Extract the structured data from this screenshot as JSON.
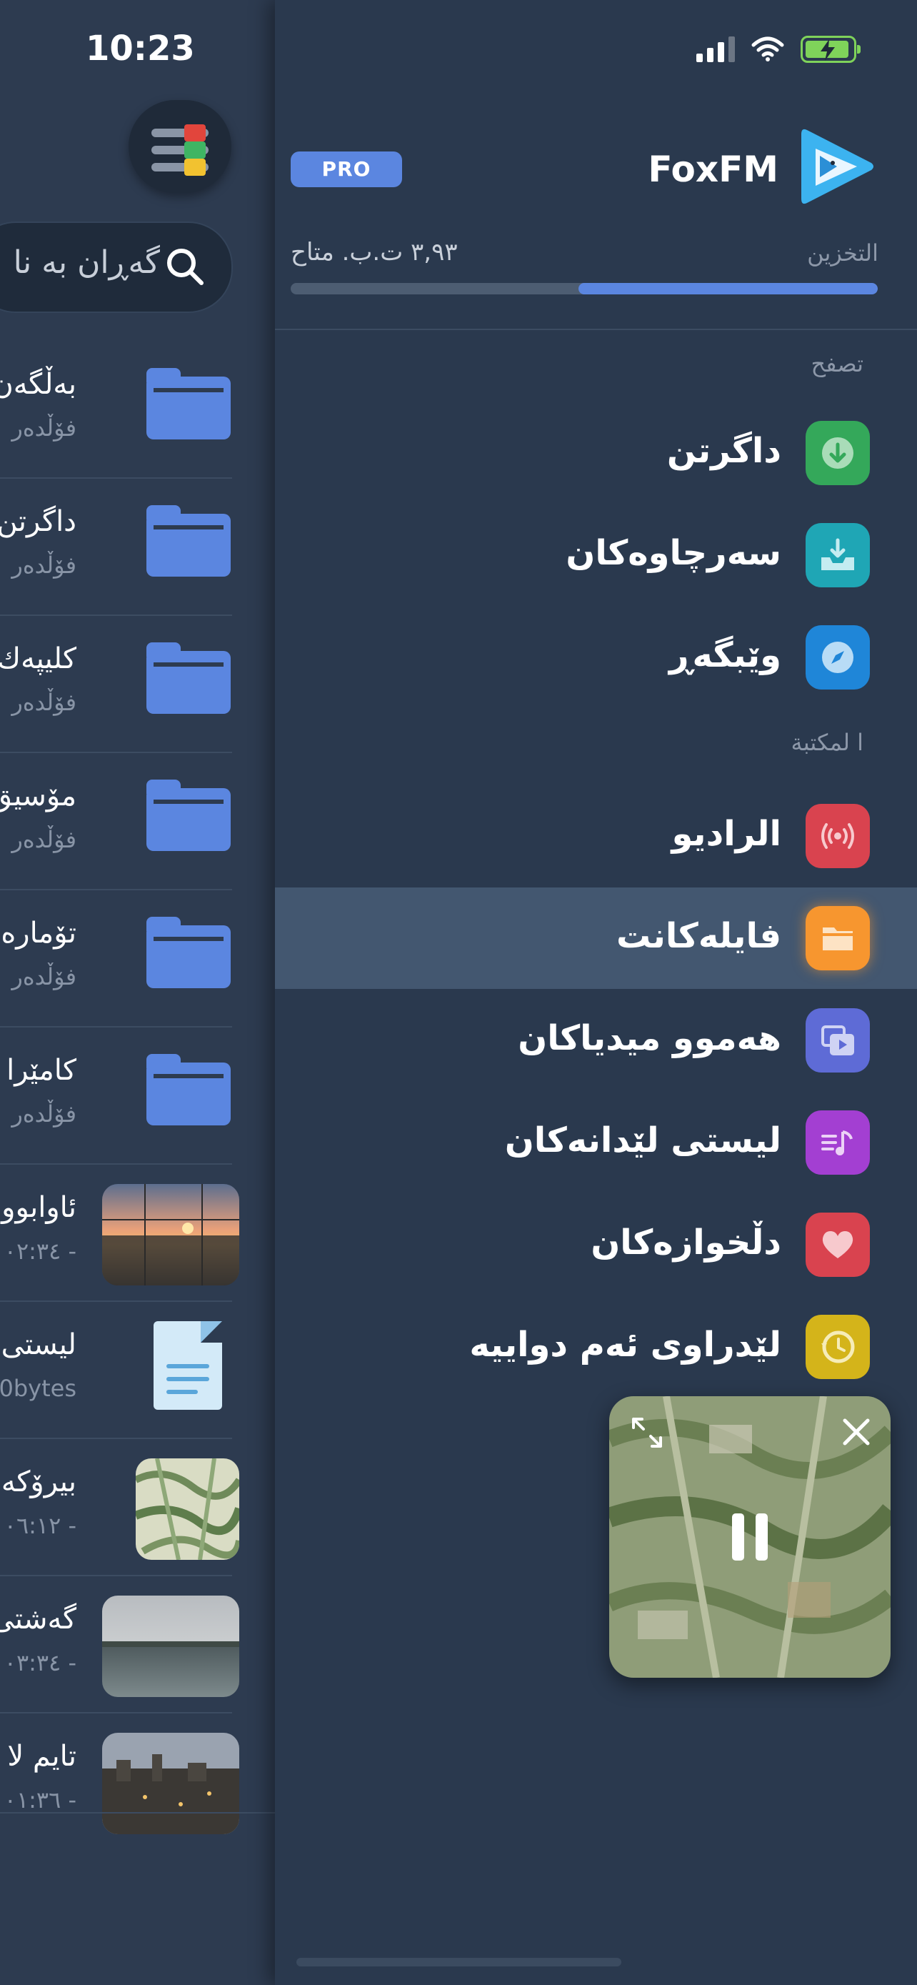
{
  "status_bar": {
    "time": "10:23",
    "icons": [
      "signal-icon",
      "wifi-icon",
      "battery-charging-icon"
    ],
    "battery_color": "#7fd35a"
  },
  "files_panel": {
    "filter_button_icon": "filter-sliders-icon",
    "search": {
      "placeholder": "گەڕان بە نا",
      "icon": "search-icon"
    },
    "items": [
      {
        "title": "بەڵگەن",
        "subtitle": "فۆڵدەر",
        "kind": "folder"
      },
      {
        "title": "داگرتن",
        "subtitle": "فۆڵدەر",
        "kind": "folder"
      },
      {
        "title": "كليپەك",
        "subtitle": "فۆڵدەر",
        "kind": "folder"
      },
      {
        "title": "مۆسيق",
        "subtitle": "فۆڵدەر",
        "kind": "folder"
      },
      {
        "title": "تۆمارە",
        "subtitle": "فۆڵدەر",
        "kind": "folder"
      },
      {
        "title": "كامێرا",
        "subtitle": "فۆڵدەر",
        "kind": "folder"
      },
      {
        "title": "ئاوابوو",
        "subtitle": "٠٢:٣٤ -",
        "kind": "video-sunset"
      },
      {
        "title": "ليستی",
        "subtitle": "0bytes",
        "kind": "document"
      },
      {
        "title": "بيرۆكە",
        "subtitle": "٠٦:١٢ -",
        "kind": "image-map"
      },
      {
        "title": "گەشتی",
        "subtitle": "٠٣:٣٤ -",
        "kind": "video-lake"
      },
      {
        "title": "تايم لا",
        "subtitle": "٠١:٣٦ -",
        "kind": "video-city"
      }
    ]
  },
  "sidebar": {
    "app_name": "FoxFM",
    "pro_badge": "PRO",
    "storage": {
      "label": "التخزين",
      "value": "٣,٩٣ ت.ب. متاح",
      "used_fraction": 0.51
    },
    "sections": [
      {
        "label": "تصفح",
        "items": [
          {
            "label": "داگرتن",
            "icon": "download-icon",
            "color": "#34a85a"
          },
          {
            "label": "سەرچاوەكان",
            "icon": "inbox-tray-icon",
            "color": "#1fa6b5"
          },
          {
            "label": "وێبگەڕ",
            "icon": "compass-icon",
            "color": "#1f86d8"
          }
        ]
      },
      {
        "label": "ا لمكتبة",
        "items": [
          {
            "label": "الراديو",
            "icon": "radio-broadcast-icon",
            "color": "#d9434f"
          },
          {
            "label": "فايلەكانت",
            "icon": "folder-icon",
            "color": "#f7962f",
            "active": true
          },
          {
            "label": "هەموو ميدياكان",
            "icon": "media-stack-icon",
            "color": "#5e6bd6"
          },
          {
            "label": "ليستی لێدانەكان",
            "icon": "playlist-icon",
            "color": "#a33fd2"
          },
          {
            "label": "دڵخوازەكان",
            "icon": "heart-icon",
            "color": "#d9434f"
          },
          {
            "label": "لێدراوی ئەم دواييە",
            "icon": "history-icon",
            "color": "#d4b41a"
          }
        ]
      }
    ]
  },
  "mini_player": {
    "expand_icon": "expand-icon",
    "close_icon": "close-icon",
    "pause_icon": "pause-icon"
  },
  "colors": {
    "accent": "#5b86e0",
    "panel_bg": "#2a394e",
    "active_row": "#435770"
  }
}
